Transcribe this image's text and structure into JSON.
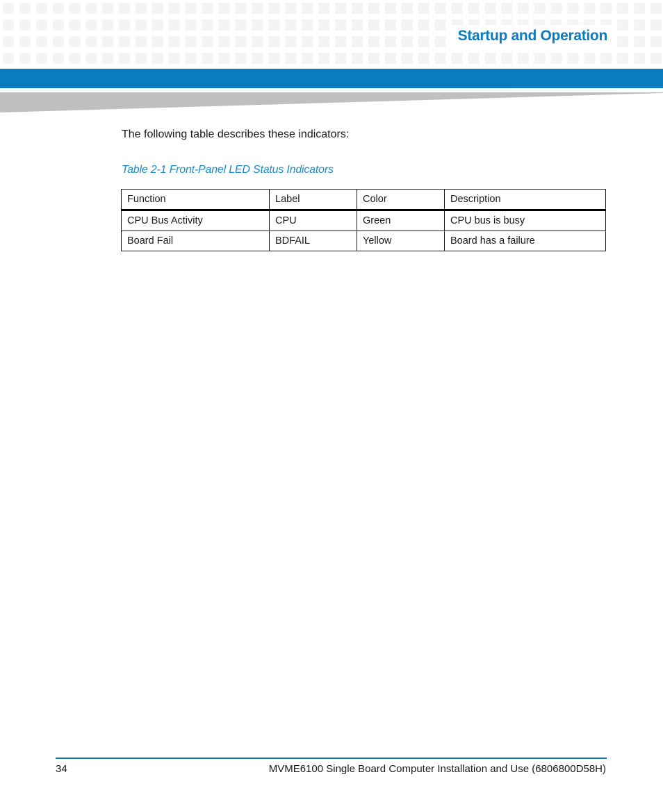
{
  "header": {
    "section_title": "Startup and Operation",
    "colors": {
      "accent_blue": "#0a7bbd",
      "band_grey": "#bebfc0",
      "pattern_grey": "#f4f4f4"
    }
  },
  "body": {
    "intro_text": "The following table describes these indicators:",
    "table_caption": "Table 2-1 Front-Panel LED Status Indicators",
    "table": {
      "headers": [
        "Function",
        "Label",
        "Color",
        "Description"
      ],
      "rows": [
        [
          "CPU Bus Activity",
          "CPU",
          "Green",
          "CPU bus is busy"
        ],
        [
          "Board Fail",
          "BDFAIL",
          "Yellow",
          "Board has a failure"
        ]
      ]
    }
  },
  "footer": {
    "page_number": "34",
    "document_title": "MVME6100 Single Board Computer Installation and Use (6806800D58H)"
  }
}
